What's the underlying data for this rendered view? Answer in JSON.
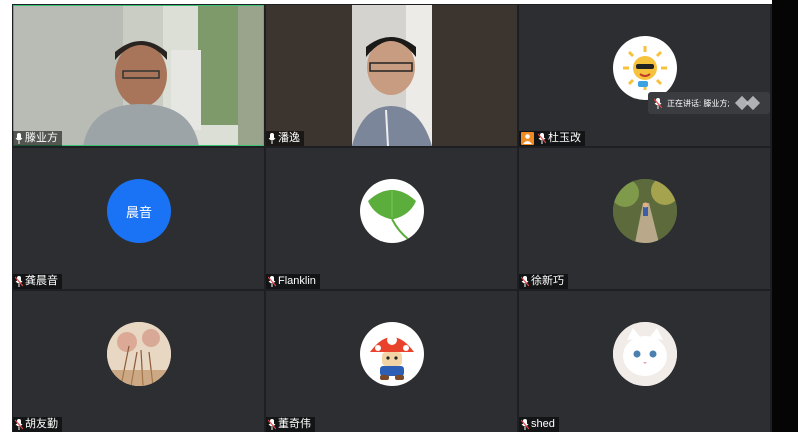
{
  "participants": [
    {
      "name": "滕业方"
    },
    {
      "name": "潘逸"
    },
    {
      "name": "杜玉改"
    },
    {
      "name": "龚晨音",
      "avatar_text": "晨音",
      "avatar_color": "#1a73f5"
    },
    {
      "name": "Flanklin"
    },
    {
      "name": "徐新巧"
    },
    {
      "name": "胡友勤"
    },
    {
      "name": "董奇伟"
    },
    {
      "name": "shed"
    }
  ],
  "speaking_indicator": {
    "label": "正在讲话: 滕业方;"
  },
  "colors": {
    "active_border": "#38c172",
    "host_badge": "#f08a24",
    "tile_bg": "#2c2e31"
  }
}
